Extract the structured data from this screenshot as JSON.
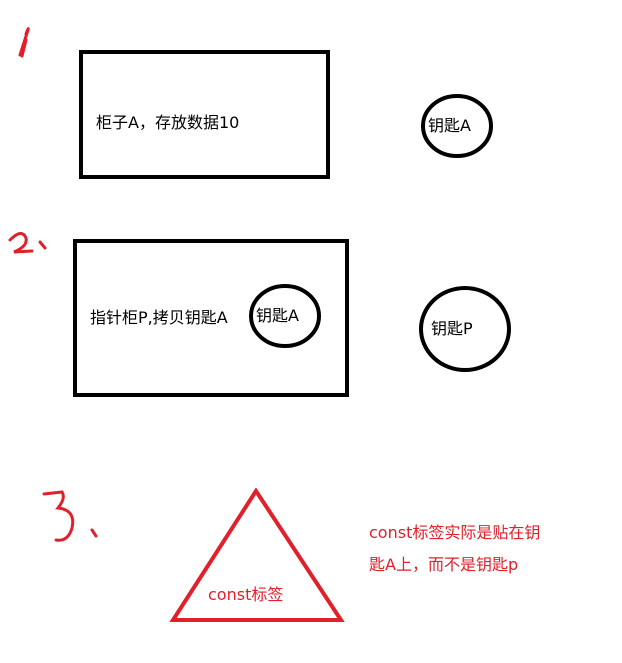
{
  "steps": {
    "step1": "1",
    "step2": "2、",
    "step3": "3、"
  },
  "step1": {
    "box_label": "柜子A，存放数据10",
    "key_label": "钥匙A"
  },
  "step2": {
    "box_label": "指针柜P,拷贝钥匙A",
    "inner_key_label": "钥匙A",
    "key_label": "钥匙P"
  },
  "step3": {
    "triangle_label": "const标签",
    "note_line1": "const标签实际是贴在钥",
    "note_line2": "匙A上，而不是钥匙p"
  },
  "colors": {
    "ink": "#000000",
    "annotation_red": "#e0202a"
  }
}
